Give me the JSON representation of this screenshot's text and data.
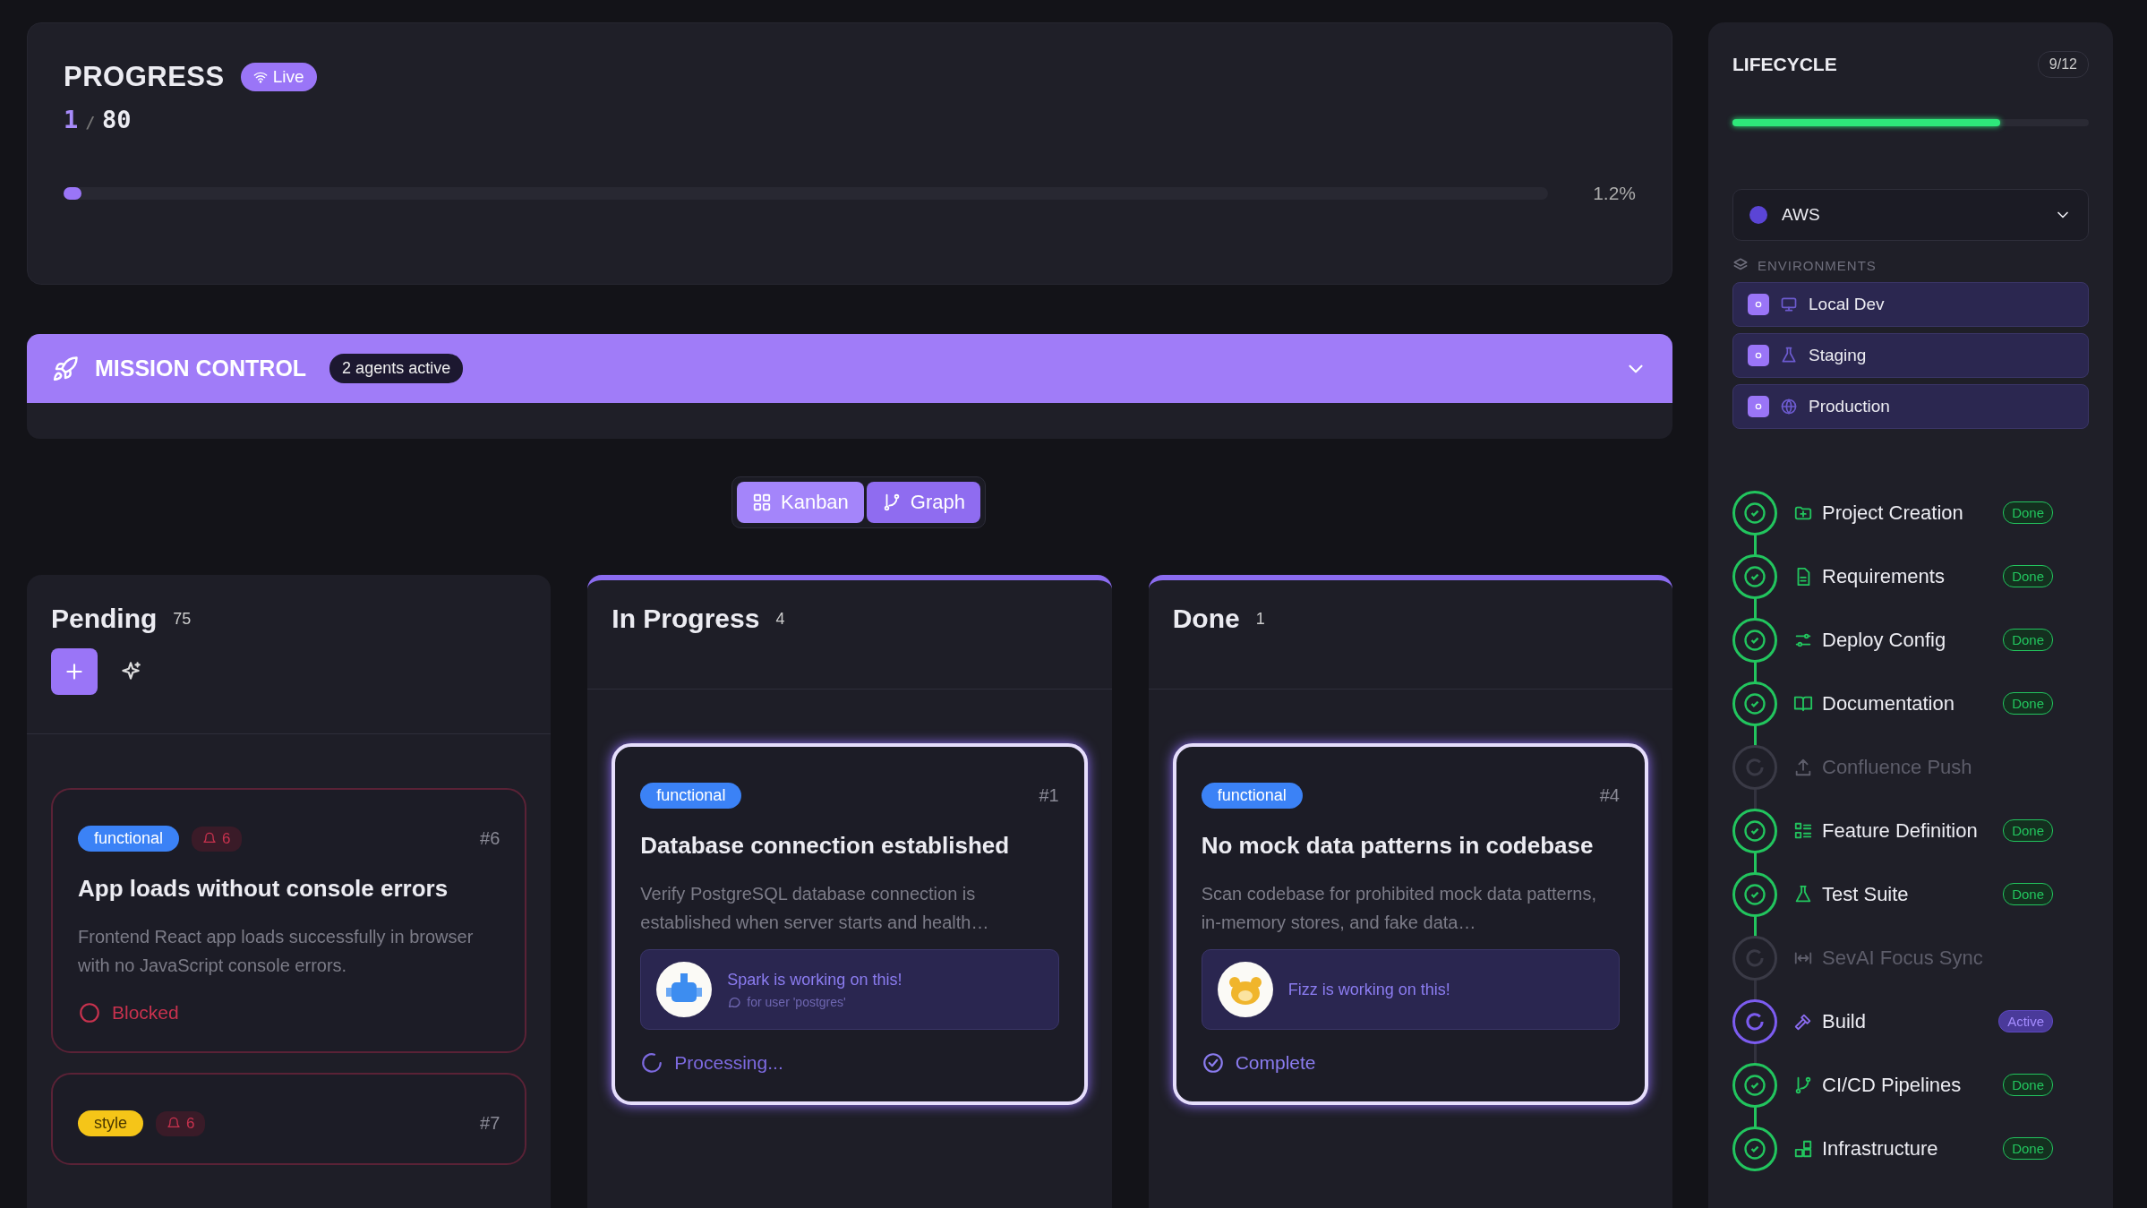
{
  "progress": {
    "title": "PROGRESS",
    "live_badge": "Live",
    "done": "1",
    "separator": "/",
    "total": "80",
    "level": 0.012,
    "percent": "1.2%"
  },
  "mission_control": {
    "title": "MISSION CONTROL",
    "agents_badge": "2 agents active"
  },
  "view_toggle": [
    {
      "label": "Kanban",
      "selected": true
    },
    {
      "label": "Graph",
      "selected": false
    }
  ],
  "columns": [
    {
      "title": "Pending",
      "count": "75",
      "highlighted": false,
      "has_actions": true,
      "cards": [
        {
          "tag": {
            "label": "functional",
            "color": "#3b82f6"
          },
          "blocked_count": "6",
          "number": "#6",
          "title": "App loads without console errors",
          "description": "Frontend React app loads successfully in browser with no JavaScript console errors.",
          "status": {
            "kind": "blocked",
            "label": "Blocked"
          }
        },
        {
          "tag": {
            "label": "style",
            "color": "#f5c518"
          },
          "blocked_count": "6",
          "number": "#7"
        }
      ]
    },
    {
      "title": "In Progress",
      "count": "4",
      "highlighted": true,
      "has_actions": false,
      "cards": [
        {
          "tag": {
            "label": "functional",
            "color": "#3b82f6"
          },
          "number": "#1",
          "title": "Database connection established",
          "description": "Verify PostgreSQL database connection is established when server starts and health…",
          "agent": {
            "message": "Spark is working on this!",
            "detail": "for user 'postgres'"
          },
          "status": {
            "kind": "processing",
            "label": "Processing..."
          }
        }
      ]
    },
    {
      "title": "Done",
      "count": "1",
      "highlighted": true,
      "has_actions": false,
      "cards": [
        {
          "tag": {
            "label": "functional",
            "color": "#3b82f6"
          },
          "number": "#4",
          "title": "No mock data patterns in codebase",
          "description": "Scan codebase for prohibited mock data patterns, in-memory stores, and fake data…",
          "agent": {
            "message": "Fizz is working on this!"
          },
          "status": {
            "kind": "complete",
            "label": "Complete"
          }
        }
      ]
    }
  ],
  "lifecycle": {
    "title": "LIFECYCLE",
    "count": "9/12",
    "level": 0.75,
    "provider": "AWS",
    "environments_heading": "ENVIRONMENTS",
    "environments": [
      {
        "label": "Local Dev"
      },
      {
        "label": "Staging"
      },
      {
        "label": "Production"
      }
    ],
    "steps": [
      {
        "label": "Project Creation",
        "kind": "done",
        "badge": "Done"
      },
      {
        "label": "Requirements",
        "kind": "done",
        "badge": "Done"
      },
      {
        "label": "Deploy Config",
        "kind": "done",
        "badge": "Done"
      },
      {
        "label": "Documentation",
        "kind": "done",
        "badge": "Done"
      },
      {
        "label": "Confluence Push",
        "kind": "pending"
      },
      {
        "label": "Feature Definition",
        "kind": "done",
        "badge": "Done"
      },
      {
        "label": "Test Suite",
        "kind": "done",
        "badge": "Done"
      },
      {
        "label": "SevAI Focus Sync",
        "kind": "pending"
      },
      {
        "label": "Build",
        "kind": "active",
        "badge": "Active"
      },
      {
        "label": "CI/CD Pipelines",
        "kind": "done",
        "badge": "Done"
      },
      {
        "label": "Infrastructure",
        "kind": "done",
        "badge": "Done"
      }
    ]
  }
}
